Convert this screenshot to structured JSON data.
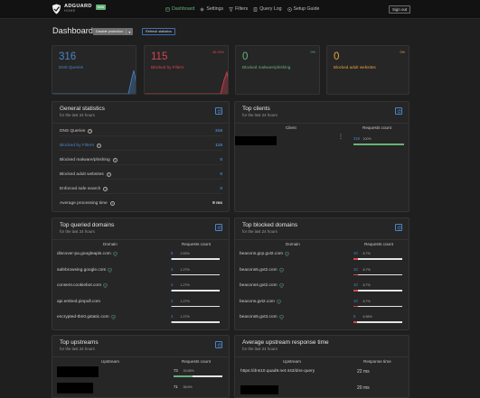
{
  "header": {
    "logo_name": "ADGUARD",
    "logo_sub": "HOME",
    "logo_badge": "beta",
    "nav": [
      {
        "label": "Dashboard",
        "icon": "dashboard-icon",
        "active": true
      },
      {
        "label": "Settings",
        "icon": "gear-icon",
        "active": false
      },
      {
        "label": "Filters",
        "icon": "filter-icon",
        "active": false
      },
      {
        "label": "Query Log",
        "icon": "document-icon",
        "active": false
      },
      {
        "label": "Setup Guide",
        "icon": "help-circle-icon",
        "active": false
      }
    ],
    "signout": "Sign out"
  },
  "page": {
    "title": "Dashboard",
    "disable_protection": "Disable protection",
    "refresh_statistics": "Refresh statistics"
  },
  "stats": [
    {
      "value": "316",
      "label": "DNS Queries",
      "percent": "",
      "color": "#4a84c8"
    },
    {
      "value": "115",
      "label": "Blocked by Filters",
      "percent": "36.39%",
      "color": "#d64550"
    },
    {
      "value": "0",
      "label": "Blocked malware/phishing",
      "percent": "0%",
      "color": "#67b279"
    },
    {
      "value": "0",
      "label": "Blocked adult websites",
      "percent": "0%",
      "color": "#e6a23c"
    }
  ],
  "general": {
    "title": "General statistics",
    "subtitle": "for the last 24 hours",
    "rows": [
      {
        "label": "DNS Queries",
        "value": "316",
        "label_color": "#c8c8c8",
        "value_color": "#4a84c8"
      },
      {
        "label": "Blocked by Filters",
        "value": "115",
        "label_color": "#4a84c8",
        "value_color": "#4a84c8"
      },
      {
        "label": "Blocked malware/phishing",
        "value": "0",
        "label_color": "#c8c8c8",
        "value_color": "#4a84c8"
      },
      {
        "label": "Blocked adult websites",
        "value": "0",
        "label_color": "#c8c8c8",
        "value_color": "#4a84c8"
      },
      {
        "label": "Enforced safe search",
        "value": "0",
        "label_color": "#c8c8c8",
        "value_color": "#4a84c8"
      },
      {
        "label": "Average processing time",
        "value": "9 ms",
        "label_color": "#c8c8c8",
        "value_color": "#e6e6e6"
      }
    ]
  },
  "top_clients": {
    "title": "Top clients",
    "subtitle": "for the last 24 hours",
    "col_client": "Client",
    "col_requests": "Requests count",
    "rows": [
      {
        "count": "316",
        "percent": "100%",
        "fill": 1.0
      }
    ]
  },
  "top_queried": {
    "title": "Top queried domains",
    "subtitle": "for the last 24 hours",
    "col_domain": "Domain",
    "col_requests": "Requests count",
    "rows": [
      {
        "domain": "discover-pa.googleapis.com",
        "count": "8",
        "percent": "2.53%",
        "fill": 0.0253,
        "shield": true
      },
      {
        "domain": "safebrowsing.google.com",
        "count": "4",
        "percent": "1.27%",
        "fill": 0.0127,
        "shield": true
      },
      {
        "domain": "consent.cookiebot.com",
        "count": "4",
        "percent": "1.27%",
        "fill": 0.0127,
        "shield": true
      },
      {
        "domain": "api.embed.pinpoll.com",
        "count": "4",
        "percent": "1.27%",
        "fill": 0.0127,
        "shield": false
      },
      {
        "domain": "encrypted-tbn0.gstatic.com",
        "count": "4",
        "percent": "1.27%",
        "fill": 0.0127,
        "shield": true
      }
    ]
  },
  "top_blocked": {
    "title": "Top blocked domains",
    "subtitle": "for the last 24 hours",
    "col_domain": "Domain",
    "col_requests": "Requests count",
    "rows": [
      {
        "domain": "beacons.gcp.gvt2.com",
        "count": "10",
        "percent": "8.7%",
        "fill": 0.087,
        "shield": true
      },
      {
        "domain": "beacons5.gvt2.com",
        "count": "10",
        "percent": "8.7%",
        "fill": 0.087,
        "shield": true
      },
      {
        "domain": "beacons4.gvt2.com",
        "count": "10",
        "percent": "8.7%",
        "fill": 0.087,
        "shield": true
      },
      {
        "domain": "beacons.gvt2.com",
        "count": "10",
        "percent": "8.7%",
        "fill": 0.087,
        "shield": true
      },
      {
        "domain": "beacons5.gvt3.com",
        "count": "8",
        "percent": "6.96%",
        "fill": 0.0696,
        "shield": true
      }
    ]
  },
  "top_upstreams": {
    "title": "Top upstreams",
    "subtitle": "for the last 24 hours",
    "col_upstream": "Upstream",
    "col_requests": "Requests count",
    "rows": [
      {
        "count": "73",
        "percent": "39.68%",
        "fill": 0.3968
      },
      {
        "count": "71",
        "percent": "38.6%",
        "fill": 0.386
      }
    ]
  },
  "avg_upstream": {
    "title": "Average upstream response time",
    "subtitle": "for the last 24 hours",
    "col_upstream": "Upstream",
    "col_response": "Response time",
    "rows": [
      {
        "upstream": "https://dns10.quad9.net:443/dns-query",
        "time": "22 ms"
      },
      {
        "upstream": "",
        "time": "20 ms"
      }
    ]
  },
  "colors": {
    "accent_green": "#67b279",
    "accent_blue": "#4a84c8",
    "accent_red": "#d64550",
    "accent_orange": "#e6a23c",
    "background": "#1f1f1f",
    "card": "#262626"
  }
}
